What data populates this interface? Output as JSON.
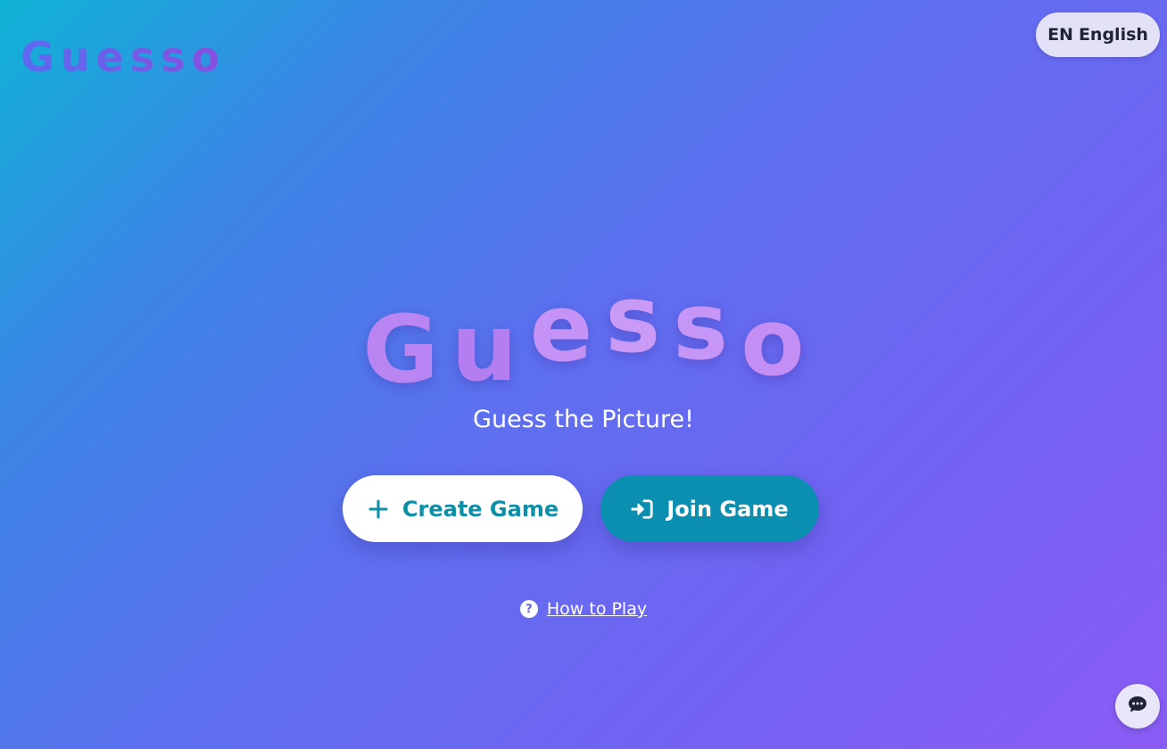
{
  "brand": {
    "logo_text": "Guesso"
  },
  "language": {
    "code": "EN",
    "label": "English"
  },
  "hero": {
    "title_letters": [
      "G",
      "u",
      "e",
      "s",
      "s",
      "o"
    ],
    "subtitle": "Guess the Picture!"
  },
  "actions": {
    "create_label": "Create Game",
    "create_icon": "plus-icon",
    "join_label": "Join Game",
    "join_icon": "sign-in-icon"
  },
  "help": {
    "icon_glyph": "?",
    "label": "How to Play"
  },
  "chat": {
    "icon": "chat-bubble-icon"
  },
  "colors": {
    "accent_teal": "#0a8fb0",
    "title_lavender": "#c08ff4",
    "gradient_start": "#0fb3d6",
    "gradient_end": "#8b5cf6"
  }
}
